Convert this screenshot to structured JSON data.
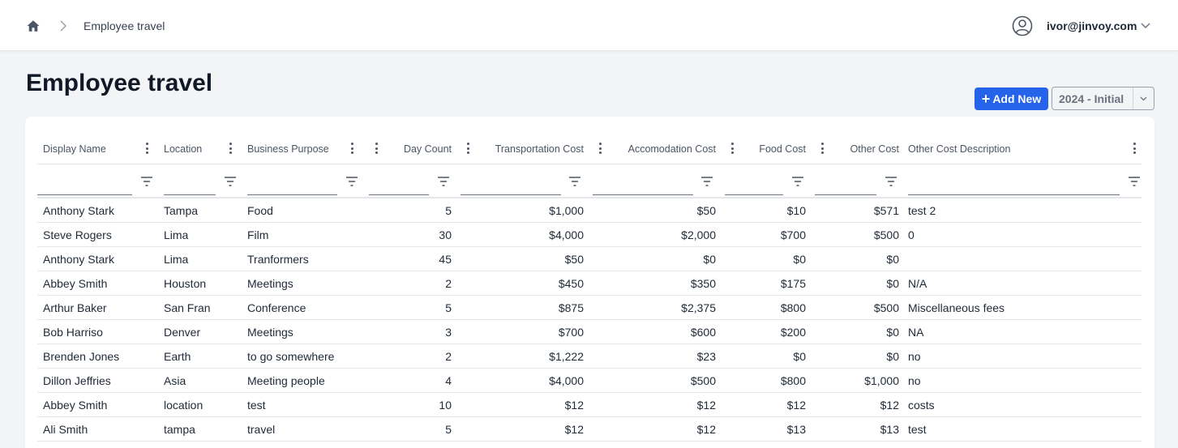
{
  "breadcrumb": {
    "home_icon": "home-icon",
    "current": "Employee travel"
  },
  "user": {
    "email": "ivor@jinvoy.com",
    "icon": "user-circle-icon"
  },
  "page": {
    "title": "Employee travel"
  },
  "toolbar": {
    "add_label": "Add New",
    "version_value": "2024 - Initial"
  },
  "colors": {
    "accent": "#2563eb",
    "background": "#f3f4f6"
  },
  "table": {
    "columns": [
      "Display Name",
      "Location",
      "Business Purpose",
      "",
      "Day Count",
      "Transportation Cost",
      "Accomodation Cost",
      "Food Cost",
      "Other Cost",
      "Other Cost Description"
    ],
    "rows": [
      [
        "Anthony Stark",
        "Tampa",
        "Food",
        "5",
        "$1,000",
        "$50",
        "$10",
        "$571",
        "test 2"
      ],
      [
        "Steve Rogers",
        "Lima",
        "Film",
        "30",
        "$4,000",
        "$2,000",
        "$700",
        "$500",
        "0"
      ],
      [
        "Anthony Stark",
        "Lima",
        "Tranformers",
        "45",
        "$50",
        "$0",
        "$0",
        "$0",
        ""
      ],
      [
        "Abbey Smith",
        "Houston",
        "Meetings",
        "2",
        "$450",
        "$350",
        "$175",
        "$0",
        "N/A"
      ],
      [
        "Arthur Baker",
        "San Fran",
        "Conference",
        "5",
        "$875",
        "$2,375",
        "$800",
        "$500",
        "Miscellaneous fees"
      ],
      [
        "Bob Harriso",
        "Denver",
        "Meetings",
        "3",
        "$700",
        "$600",
        "$200",
        "$0",
        "NA"
      ],
      [
        "Brenden Jones",
        "Earth",
        "to go somewhere",
        "2",
        "$1,222",
        "$23",
        "$0",
        "$0",
        "no"
      ],
      [
        "Dillon Jeffries",
        "Asia",
        "Meeting people",
        "4",
        "$4,000",
        "$500",
        "$800",
        "$1,000",
        "no"
      ],
      [
        "Abbey Smith",
        "location",
        "test",
        "10",
        "$12",
        "$12",
        "$12",
        "$12",
        "costs"
      ],
      [
        "Ali Smith",
        "tampa",
        "travel",
        "5",
        "$12",
        "$12",
        "$13",
        "$13",
        "test"
      ]
    ]
  }
}
